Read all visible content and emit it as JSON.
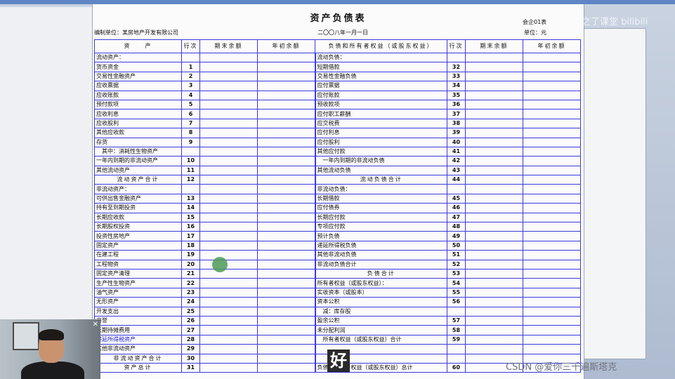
{
  "title": "资产负债表",
  "form_no": "会企01表",
  "company_label": "编制单位：某房地产开发有限公司",
  "date": "二〇〇八年一月一日",
  "unit": "单位：元",
  "headers": {
    "asset": "资　　产",
    "line": "行次",
    "end_balance": "期末余额",
    "begin_balance": "年初余额",
    "liability": "负债和所有者权益（或股东权益）",
    "line2": "行次",
    "end_balance2": "期末余额",
    "begin_balance2": "年初余额"
  },
  "rows": [
    {
      "a": "流动资产：",
      "al": "",
      "l": "流动负债：",
      "ll": ""
    },
    {
      "a": "货币资金",
      "al": "1",
      "l": "短期借款",
      "ll": "32"
    },
    {
      "a": "交易性金融资产",
      "al": "2",
      "l": "交易性金融负债",
      "ll": "33"
    },
    {
      "a": "应收票据",
      "al": "3",
      "l": "应付票据",
      "ll": "34"
    },
    {
      "a": "应收账款",
      "al": "4",
      "l": "应付账款",
      "ll": "35"
    },
    {
      "a": "预付款项",
      "al": "5",
      "l": "预收款项",
      "ll": "36"
    },
    {
      "a": "应收利息",
      "al": "6",
      "l": "应付职工薪酬",
      "ll": "37"
    },
    {
      "a": "应收股利",
      "al": "7",
      "l": "应交税费",
      "ll": "38"
    },
    {
      "a": "其他应收款",
      "al": "8",
      "l": "应付利息",
      "ll": "39"
    },
    {
      "a": "存货",
      "al": "9",
      "l": "应付股利",
      "ll": "40"
    },
    {
      "a": "其中：消耗性生物资产",
      "al": "",
      "l": "其他应付款",
      "ll": "41"
    },
    {
      "a": "一年内到期的非流动资产",
      "al": "10",
      "l": "一年内到期的非流动负债",
      "ll": "42"
    },
    {
      "a": "其他流动资产",
      "al": "11",
      "l": "其他流动负债",
      "ll": "43"
    },
    {
      "a": "流动资产合计",
      "al": "12",
      "l": "流动负债合计",
      "ll": "44"
    },
    {
      "a": "非流动资产：",
      "al": "",
      "l": "非流动负债：",
      "ll": ""
    },
    {
      "a": "可供出售金融资产",
      "al": "13",
      "l": "长期借款",
      "ll": "45"
    },
    {
      "a": "持有至到期投资",
      "al": "14",
      "l": "应付债券",
      "ll": "46"
    },
    {
      "a": "长期应收款",
      "al": "15",
      "l": "长期应付款",
      "ll": "47"
    },
    {
      "a": "长期股权投资",
      "al": "16",
      "l": "专项应付款",
      "ll": "48"
    },
    {
      "a": "投资性房地产",
      "al": "17",
      "l": "预计负债",
      "ll": "49"
    },
    {
      "a": "固定资产",
      "al": "18",
      "l": "递延所得税负债",
      "ll": "50"
    },
    {
      "a": "在建工程",
      "al": "19",
      "l": "其他非流动负债",
      "ll": "51"
    },
    {
      "a": "工程物资",
      "al": "20",
      "l": "非流动负债合计",
      "ll": "52"
    },
    {
      "a": "固定资产清理",
      "al": "21",
      "l": "负债合计",
      "ll": "53"
    },
    {
      "a": "生产性生物资产",
      "al": "22",
      "l": "所有者权益（或股东权益）：",
      "ll": "54"
    },
    {
      "a": "油气资产",
      "al": "23",
      "l": "实收资本（或股本）",
      "ll": "55"
    },
    {
      "a": "无形资产",
      "al": "24",
      "l": "资本公积",
      "ll": "56"
    },
    {
      "a": "开发支出",
      "al": "25",
      "l": "减：库存股",
      "ll": ""
    },
    {
      "a": "商誉",
      "al": "26",
      "l": "盈余公积",
      "ll": "57"
    },
    {
      "a": "长期待摊费用",
      "al": "27",
      "l": "未分配利润",
      "ll": "58"
    },
    {
      "a": "递延所得税资产",
      "al": "28",
      "l": "所有者权益（或股东权益）合计",
      "ll": "59"
    },
    {
      "a": "其他非流动资产",
      "al": "29",
      "l": "",
      "ll": ""
    },
    {
      "a": "非流动资产合计",
      "al": "30",
      "l": "",
      "ll": ""
    },
    {
      "a": "资产总计",
      "al": "31",
      "l": "负债和所有者权益（或股东权益）总计",
      "ll": "60"
    }
  ],
  "watermark_top": "之了课堂 bilibili",
  "watermark_bottom": "CSDN @爱你三千遍斯塔克",
  "subtitle": "好",
  "link_color": "#1a1ad0"
}
